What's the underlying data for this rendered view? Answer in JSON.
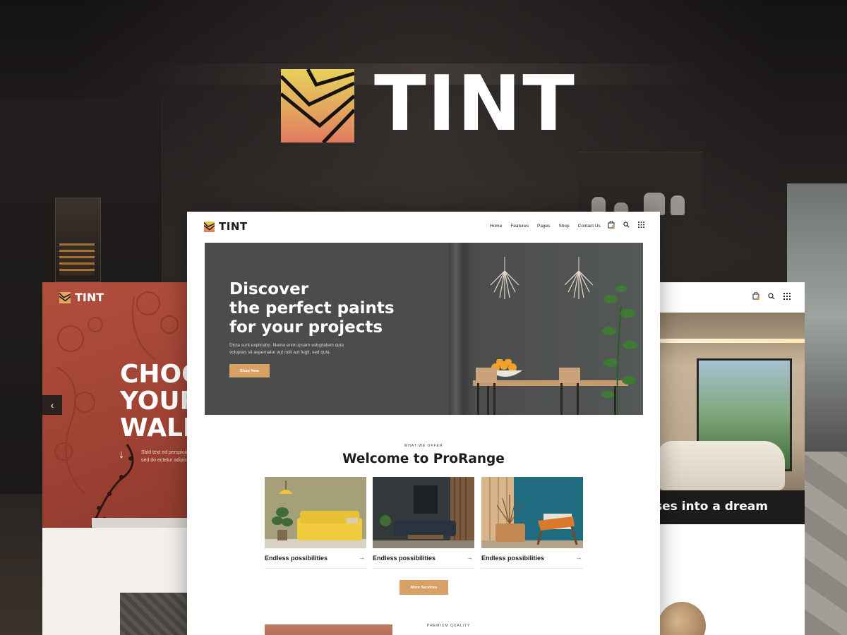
{
  "brand": {
    "name": "TINT"
  },
  "left_page": {
    "logo_text": "TINT",
    "headline_line1": "CHOC",
    "headline_line2": "YOUR",
    "headline_line3": "WALL",
    "body_line1": "Sbld text ed perspiciatis",
    "body_line2": "sed do ectetur adipiscin"
  },
  "center_page": {
    "nav": {
      "logo_text": "TINT",
      "links": [
        "Home",
        "Features",
        "Pages",
        "Shop",
        "Contact Us"
      ]
    },
    "banner": {
      "title_line1": "Discover",
      "title_line2": "the perfect paints",
      "title_line3": "for your projects",
      "subtitle_line1": "Dicta sunt explicabo. Nemo enim ipsam voluptatem quia",
      "subtitle_line2": "voluptas sit aspernatur aut odit aut fugit, sed quia.",
      "button_label": "Shop Now"
    },
    "offer": {
      "eyebrow": "WHAT WE OFFER",
      "title": "Welcome to ProRange",
      "cards": [
        {
          "label": "Endless possibilities",
          "arrow": "→"
        },
        {
          "label": "Endless possibilities",
          "arrow": "→"
        },
        {
          "label": "Endless possibilities",
          "arrow": "→"
        }
      ],
      "button_label": "More Services"
    },
    "bottom_eyebrow": "PREMIUM QUALITY"
  },
  "right_page": {
    "band_text": "ses into a dream"
  },
  "colors": {
    "accent": "#d9a066",
    "banner_wall": "#4a4d4c",
    "left_hero": "#a8483a",
    "text_dark": "#1c1c1c"
  },
  "icons": [
    "logo-mark-icon",
    "cart-icon",
    "search-icon",
    "grid-menu-icon",
    "chevron-left-icon",
    "arrow-down-icon",
    "arrow-right-icon"
  ]
}
